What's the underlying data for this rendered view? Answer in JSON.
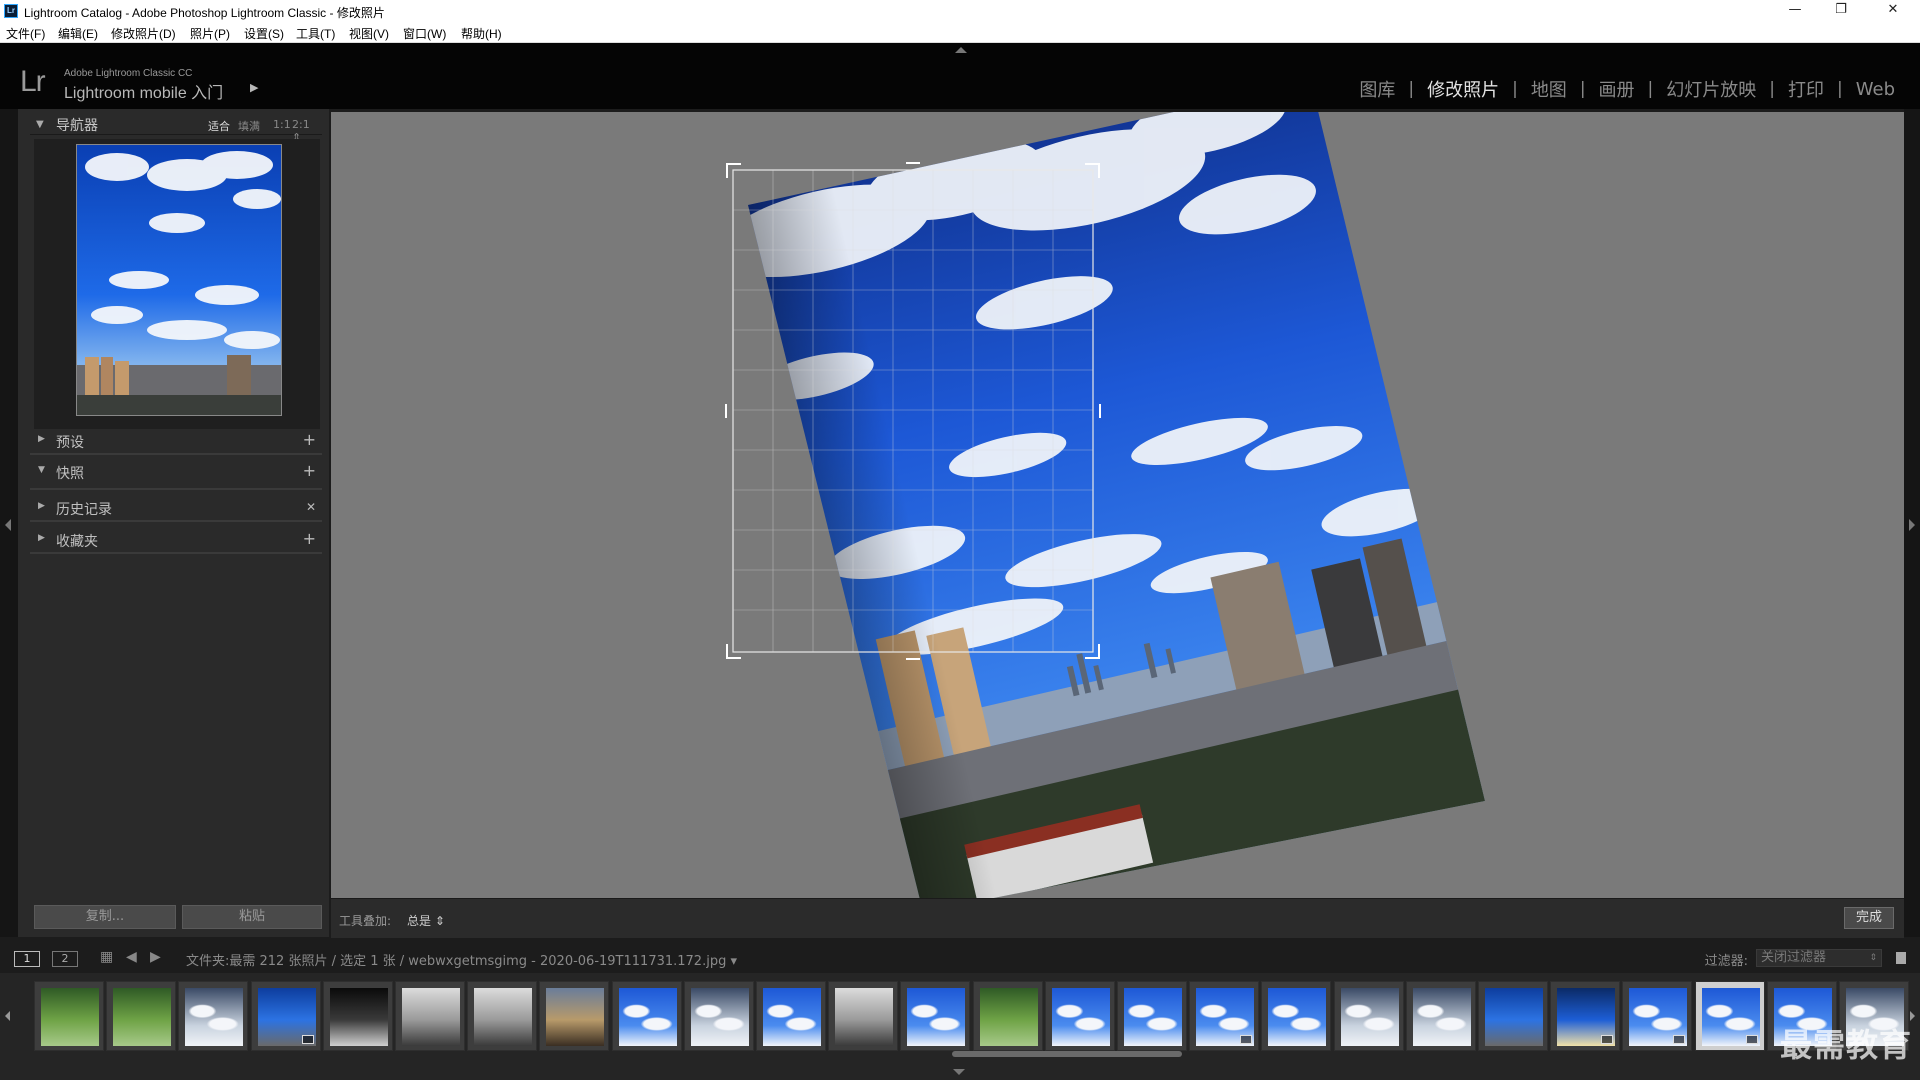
{
  "window": {
    "title": "Lightroom Catalog - Adobe Photoshop Lightroom Classic - 修改照片",
    "app_badge": "Lr",
    "controls": {
      "minimize": "—",
      "restore": "❐",
      "close": "✕"
    }
  },
  "menu": [
    "文件(F)",
    "编辑(E)",
    "修改照片(D)",
    "照片(P)",
    "设置(S)",
    "工具(T)",
    "视图(V)",
    "窗口(W)",
    "帮助(H)"
  ],
  "identity": {
    "logo": "Lr",
    "small": "Adobe Lightroom Classic CC",
    "brand": "Lightroom mobile 入门",
    "arrow": "▶"
  },
  "modules": [
    {
      "label": "图库",
      "active": false
    },
    {
      "label": "修改照片",
      "active": true
    },
    {
      "label": "地图",
      "active": false
    },
    {
      "label": "画册",
      "active": false
    },
    {
      "label": "幻灯片放映",
      "active": false
    },
    {
      "label": "打印",
      "active": false
    },
    {
      "label": "Web",
      "active": false
    }
  ],
  "navigator": {
    "label": "导航器",
    "zoom": [
      "适合",
      "填满",
      "1:1",
      "2:1 ⇕"
    ],
    "active_zoom": "适合"
  },
  "panels": [
    {
      "label": "预设",
      "action": "+",
      "expanded": false
    },
    {
      "label": "快照",
      "action": "+",
      "expanded": true
    },
    {
      "label": "历史记录",
      "action": "✕",
      "expanded": false
    },
    {
      "label": "收藏夹",
      "action": "+",
      "expanded": false
    }
  ],
  "left_buttons": {
    "copy": "复制...",
    "paste": "粘贴"
  },
  "toolbar": {
    "overlay_label": "工具叠加:",
    "overlay_value": "总是 ⇕",
    "done": "完成"
  },
  "filmstrip_bar": {
    "page1": "1",
    "page2": "2",
    "breadcrumb": "文件夹:最需 212 张照片 / 选定 1 张 / webwxgetmsgimg - 2020-06-19T111731.172.jpg ▾",
    "filter_label": "过滤器:",
    "filter_value": "关闭过滤器"
  },
  "filmstrip": {
    "count": 26,
    "selected_index": 23,
    "thumb_types": [
      "green",
      "green",
      "cloud",
      "city",
      "night",
      "bw",
      "bw",
      "sunset",
      "sky",
      "cloud",
      "sky",
      "bw",
      "sky",
      "green",
      "sky",
      "sky",
      "sky",
      "sky",
      "cloud",
      "cloud",
      "city",
      "sun",
      "sky",
      "sky",
      "sky",
      "cloud"
    ]
  },
  "watermark": "最需教育",
  "colors": {
    "accent_panel": "#2a2a2a",
    "edit_bg": "#7a7a7a",
    "active_module": "#e2e2e2"
  }
}
